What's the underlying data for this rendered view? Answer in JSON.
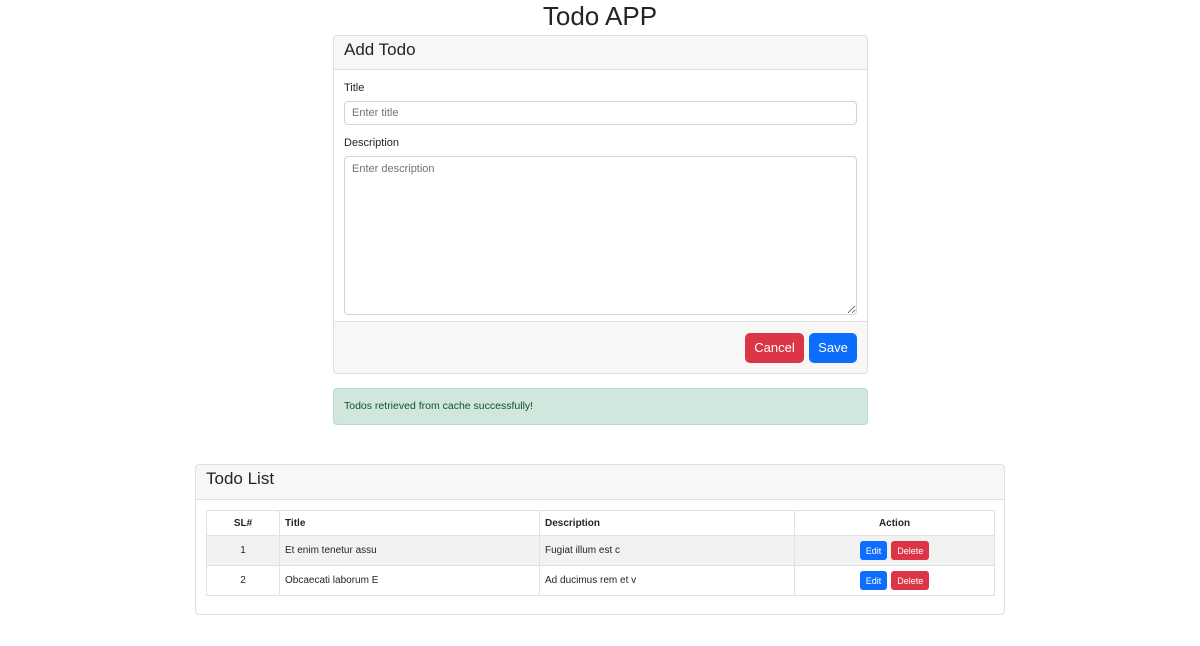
{
  "app": {
    "title": "Todo APP"
  },
  "add_form": {
    "header": "Add Todo",
    "title_label": "Title",
    "title_placeholder": "Enter title",
    "description_label": "Description",
    "description_placeholder": "Enter description",
    "cancel_label": "Cancel",
    "save_label": "Save"
  },
  "alert": {
    "message": "Todos retrieved from cache successfully!",
    "color": "#d1e7dd"
  },
  "todo_list": {
    "header": "Todo List",
    "columns": [
      "SL#",
      "Title",
      "Description",
      "Action"
    ],
    "rows": [
      {
        "sl": "1",
        "title": "Et enim tenetur assu",
        "description": "Fugiat illum est c",
        "edit": "Edit",
        "delete": "Delete"
      },
      {
        "sl": "2",
        "title": "Obcaecati laborum E",
        "description": "Ad ducimus rem et v",
        "edit": "Edit",
        "delete": "Delete"
      }
    ]
  },
  "colors": {
    "primary": "#0d6efd",
    "danger": "#dc3545",
    "success_bg": "#d1e7dd"
  }
}
